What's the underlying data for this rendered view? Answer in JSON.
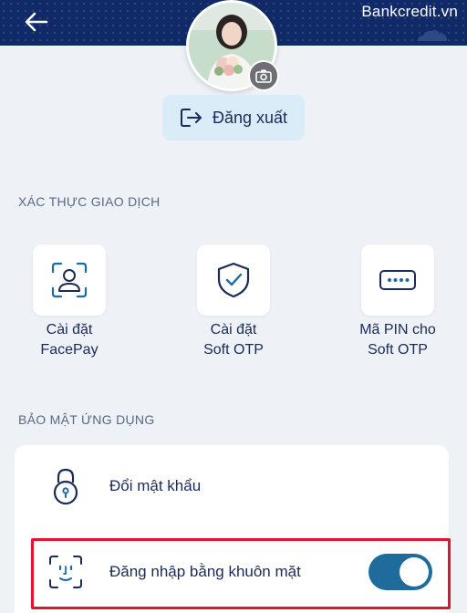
{
  "header": {
    "watermark": "Bankcredit.vn",
    "back_icon": "arrow-left-icon"
  },
  "profile": {
    "avatar": "user-photo",
    "camera_icon": "camera-icon"
  },
  "logout": {
    "label": "Đăng xuất",
    "icon": "logout-icon"
  },
  "transaction_auth": {
    "title": "XÁC THỰC GIAO DỊCH",
    "items": [
      {
        "line1": "Cài đặt",
        "line2": "FacePay",
        "icon": "face-scan-icon"
      },
      {
        "line1": "Cài đặt",
        "line2": "Soft OTP",
        "icon": "shield-check-icon"
      },
      {
        "line1": "Mã PIN cho",
        "line2": "Soft OTP",
        "icon": "pin-dots-icon"
      }
    ]
  },
  "app_security": {
    "title": "BẢO MẬT ỨNG DỤNG",
    "items": [
      {
        "label": "Đổi mật khẩu",
        "icon": "lock-icon"
      },
      {
        "label": "Đăng nhập bằng khuôn mặt",
        "icon": "face-id-icon",
        "toggle_on": true
      }
    ]
  },
  "colors": {
    "header": "#0f2a66",
    "accent": "#1f6c9c",
    "highlight": "#e0142e",
    "background": "#eef1f6"
  }
}
